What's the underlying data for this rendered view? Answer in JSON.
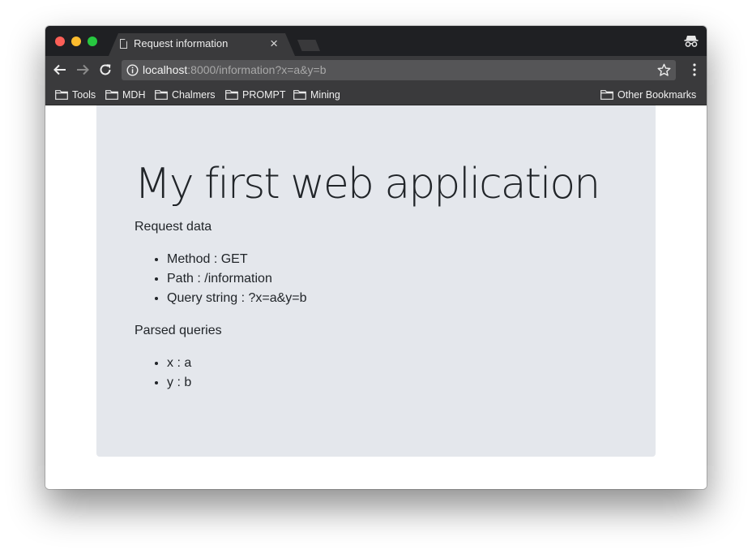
{
  "browser": {
    "tab": {
      "title": "Request information",
      "close_glyph": "×",
      "icon": "document-icon"
    },
    "url": {
      "host": "localhost",
      "rest": ":8000/information?x=a&y=b"
    },
    "bookmarks": [
      {
        "label": "Tools",
        "icon": "folder-icon"
      },
      {
        "label": "MDH",
        "icon": "folder-icon"
      },
      {
        "label": "Chalmers",
        "icon": "folder-icon"
      },
      {
        "label": "PROMPT",
        "icon": "folder-icon"
      },
      {
        "label": "Mining",
        "icon": "folder-icon"
      }
    ],
    "other_bookmarks": "Other Bookmarks",
    "colors": {
      "titlebar": "#1f2023",
      "toolbar": "#3a3a3c",
      "omnibox": "#555557",
      "close": "#fc5f57",
      "minimize": "#fdbc2e",
      "maximize": "#27c840"
    }
  },
  "page": {
    "heading": "My first web application",
    "request_label": "Request data",
    "request_items": [
      "Method : GET",
      "Path : /information",
      "Query string : ?x=a&y=b"
    ],
    "parsed_label": "Parsed queries",
    "parsed_items": [
      "x : a",
      "y : b"
    ],
    "colors": {
      "jumbotron": "#e4e7ec",
      "text": "#212529"
    }
  }
}
